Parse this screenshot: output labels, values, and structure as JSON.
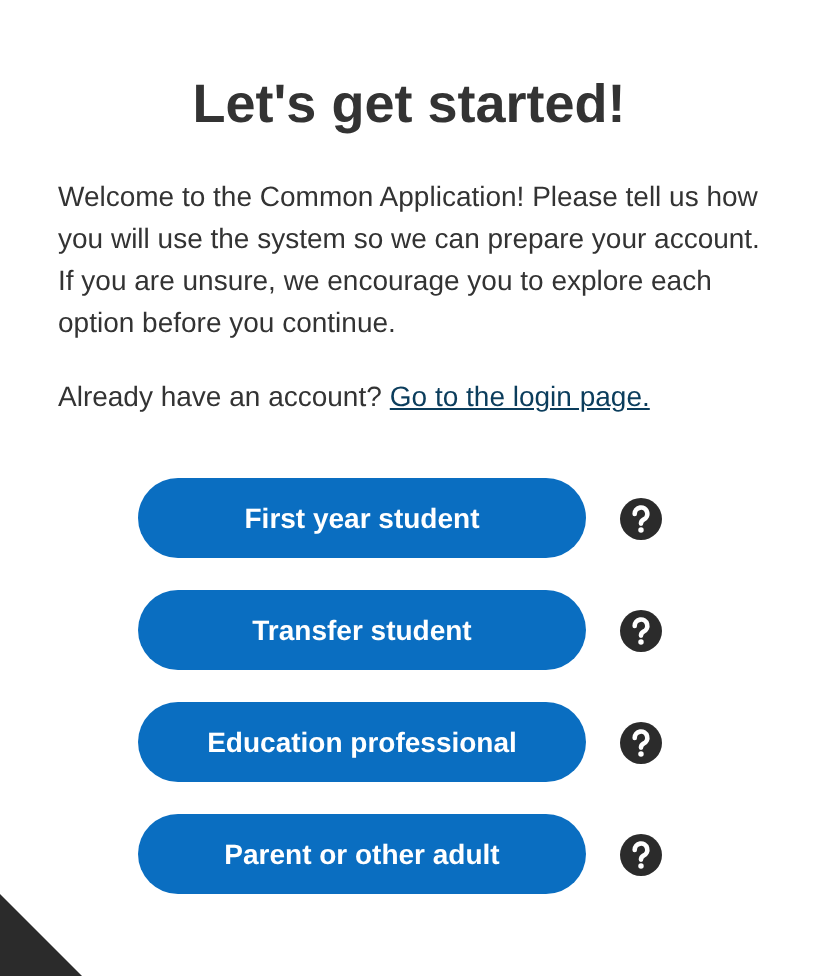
{
  "title": "Let's get started!",
  "intro": "Welcome to the Common Application! Please tell us how you will use the system so we can prepare your account. If you are unsure, we encourage you to explore each option before you continue.",
  "account_prompt": {
    "text": "Already have an account?",
    "link": "Go to the login page."
  },
  "roles": [
    {
      "label": "First year student"
    },
    {
      "label": "Transfer student"
    },
    {
      "label": "Education professional"
    },
    {
      "label": "Parent or other adult"
    }
  ]
}
